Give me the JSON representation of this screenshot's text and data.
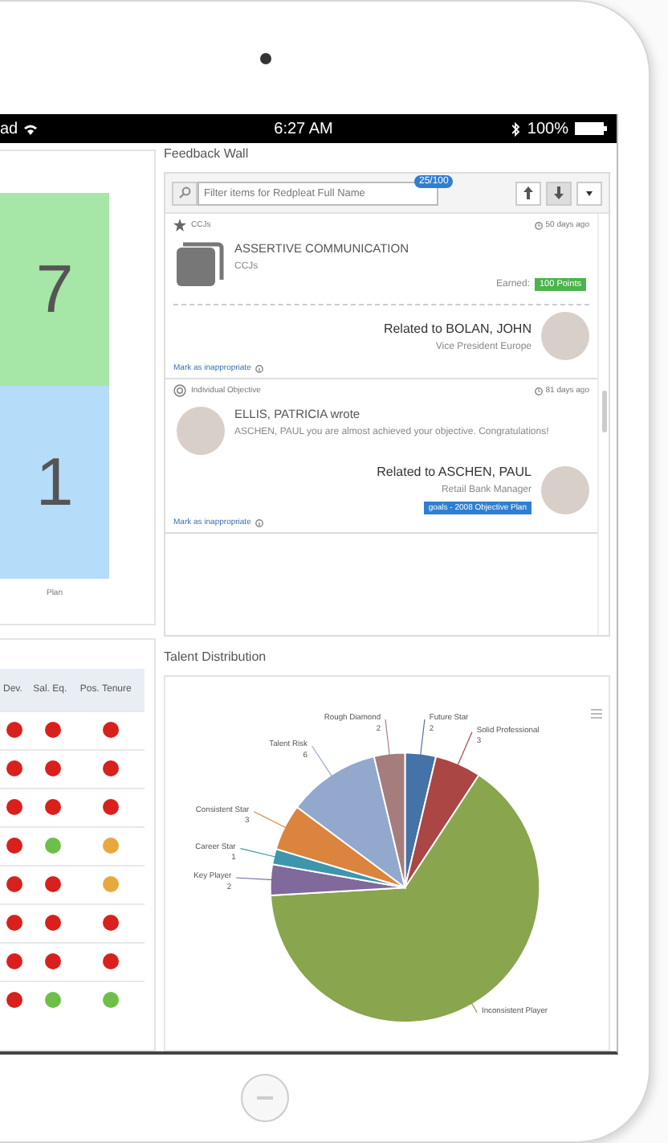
{
  "status_bar": {
    "carrier": "ad",
    "time": "6:27 AM",
    "battery": "100%"
  },
  "summary_panel": {
    "blocks": [
      {
        "value": "7",
        "color": "#a6e6a6"
      },
      {
        "value": "1",
        "color": "#b5dcf8"
      }
    ],
    "label": "Plan"
  },
  "traffic_table": {
    "columns": [
      "Dev.",
      "Sal. Eq.",
      "Pos. Tenure"
    ],
    "rows": [
      {
        "cells": [
          {
            "color": "#d9201c"
          },
          {
            "color": "#d9201c"
          },
          {
            "color": "#d9201c"
          }
        ]
      },
      {
        "cells": [
          {
            "color": "#d9201c"
          },
          {
            "color": "#d9201c"
          },
          {
            "color": "#d9201c"
          }
        ]
      },
      {
        "cells": [
          {
            "color": "#d9201c"
          },
          {
            "color": "#d9201c"
          },
          {
            "color": "#d9201c"
          }
        ]
      },
      {
        "cells": [
          {
            "color": "#d9201c"
          },
          {
            "color": "#6cc04a"
          },
          {
            "color": "#e8a83d"
          }
        ]
      },
      {
        "cells": [
          {
            "color": "#d9201c"
          },
          {
            "color": "#d9201c"
          },
          {
            "color": "#e8a83d"
          }
        ]
      },
      {
        "cells": [
          {
            "color": "#d9201c"
          },
          {
            "color": "#d9201c"
          },
          {
            "color": "#d9201c"
          }
        ]
      },
      {
        "cells": [
          {
            "color": "#d9201c"
          },
          {
            "color": "#d9201c"
          },
          {
            "color": "#d9201c"
          }
        ]
      },
      {
        "cells": [
          {
            "color": "#d9201c"
          },
          {
            "color": "#6cc04a"
          },
          {
            "color": "#6cc04a"
          }
        ]
      }
    ]
  },
  "feedback_wall": {
    "title": "Feedback Wall",
    "search": {
      "placeholder": "Filter items for Redpleat Full Name"
    },
    "count": "25/100",
    "sort_buttons": [
      {
        "kind": "up",
        "selected": false
      },
      {
        "kind": "down",
        "selected": true
      },
      {
        "kind": "menu",
        "selected": false
      }
    ],
    "posts": [
      {
        "kind": "achievement",
        "category": "CCJs",
        "age": "50 days ago",
        "title": "ASSERTIVE COMMUNICATION",
        "subtitle": "CCJs",
        "earned_label": "Earned:",
        "points": "100 Points",
        "related": "Related to BOLAN, JOHN",
        "role": "Vice President Europe",
        "flag_link": "Mark as inappropriate"
      },
      {
        "kind": "comment",
        "category": "Individual Objective",
        "age": "81 days ago",
        "title": "ELLIS, PATRICIA wrote",
        "subtitle": "ASCHEN, PAUL you are almost achieved your objective. Congratulations!",
        "related": "Related to ASCHEN, PAUL",
        "role": "Retail Bank Manager",
        "tag": "goals - 2008 Objective Plan",
        "flag_link": "Mark as inappropriate"
      }
    ]
  },
  "talent_distribution": {
    "chart_data": {
      "type": "pie",
      "title": "Talent Distribution",
      "categories": [
        "Future Star",
        "Solid Professional",
        "Inconsistent Player",
        "Key Player",
        "Career Star",
        "Consistent Star",
        "Talent Risk",
        "Rough Diamond"
      ],
      "values": [
        2,
        3,
        35,
        2,
        1,
        3,
        6,
        2
      ],
      "value_labels": [
        "2",
        "3",
        null,
        "2",
        "1",
        "3",
        "6",
        "2"
      ],
      "colors": [
        "#4572a7",
        "#aa4643",
        "#89a54e",
        "#80699b",
        "#3d96ae",
        "#db843d",
        "#92a8cd",
        "#a47d7c"
      ]
    }
  }
}
